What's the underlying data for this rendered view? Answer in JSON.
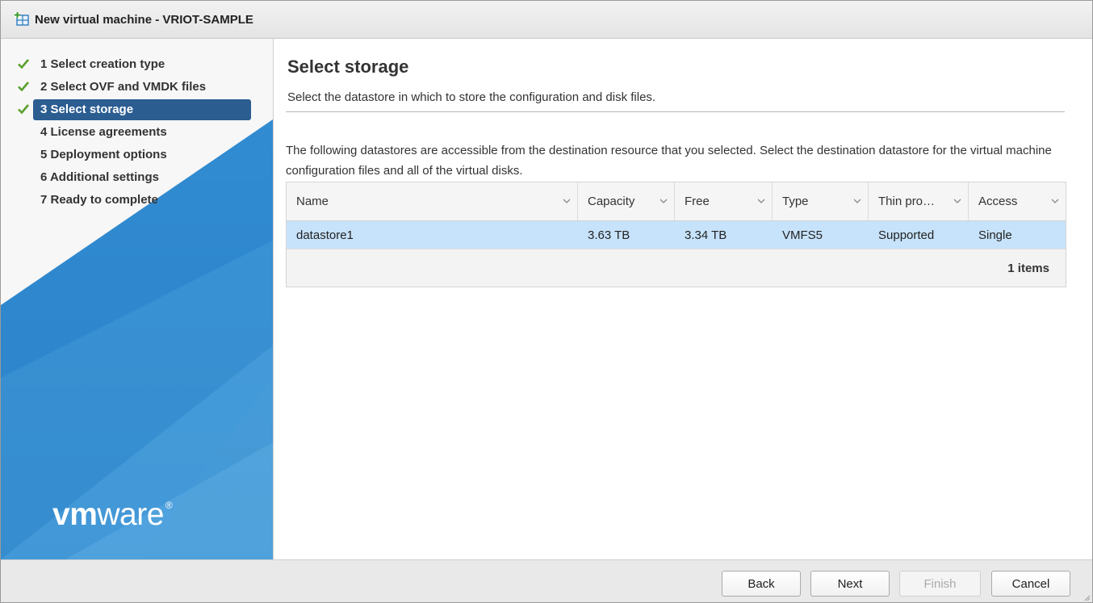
{
  "window": {
    "title": "New virtual machine - VRIOT-SAMPLE",
    "icon": "new-vm-icon"
  },
  "wizard": {
    "steps": [
      {
        "label": "1 Select creation type",
        "completed": true,
        "active": false
      },
      {
        "label": "2 Select OVF and VMDK files",
        "completed": true,
        "active": false
      },
      {
        "label": "3 Select storage",
        "completed": true,
        "active": true
      },
      {
        "label": "4 License agreements",
        "completed": false,
        "active": false
      },
      {
        "label": "5 Deployment options",
        "completed": false,
        "active": false
      },
      {
        "label": "6 Additional settings",
        "completed": false,
        "active": false
      },
      {
        "label": "7 Ready to complete",
        "completed": false,
        "active": false
      }
    ],
    "logo": {
      "bold": "vm",
      "regular": "ware",
      "mark": "®"
    }
  },
  "main": {
    "title": "Select storage",
    "subtitle": "Select the datastore in which to store the configuration and disk files.",
    "description": "The following datastores are accessible from the destination resource that you selected. Select the destination datastore for the virtual machine configuration files and all of the virtual disks."
  },
  "table": {
    "columns": [
      "Name",
      "Capacity",
      "Free",
      "Type",
      "Thin pro…",
      "Access"
    ],
    "rows": [
      [
        "datastore1",
        "3.63 TB",
        "3.34 TB",
        "VMFS5",
        "Supported",
        "Single"
      ]
    ],
    "footer": "1 items"
  },
  "buttons": {
    "back": "Back",
    "next": "Next",
    "finish": "Finish",
    "cancel": "Cancel"
  },
  "colors": {
    "active_step": "#2b5d91",
    "selected_row": "#c7e3fb",
    "check": "#5aa02c",
    "sidebar_blue": "#2f8ad0"
  }
}
